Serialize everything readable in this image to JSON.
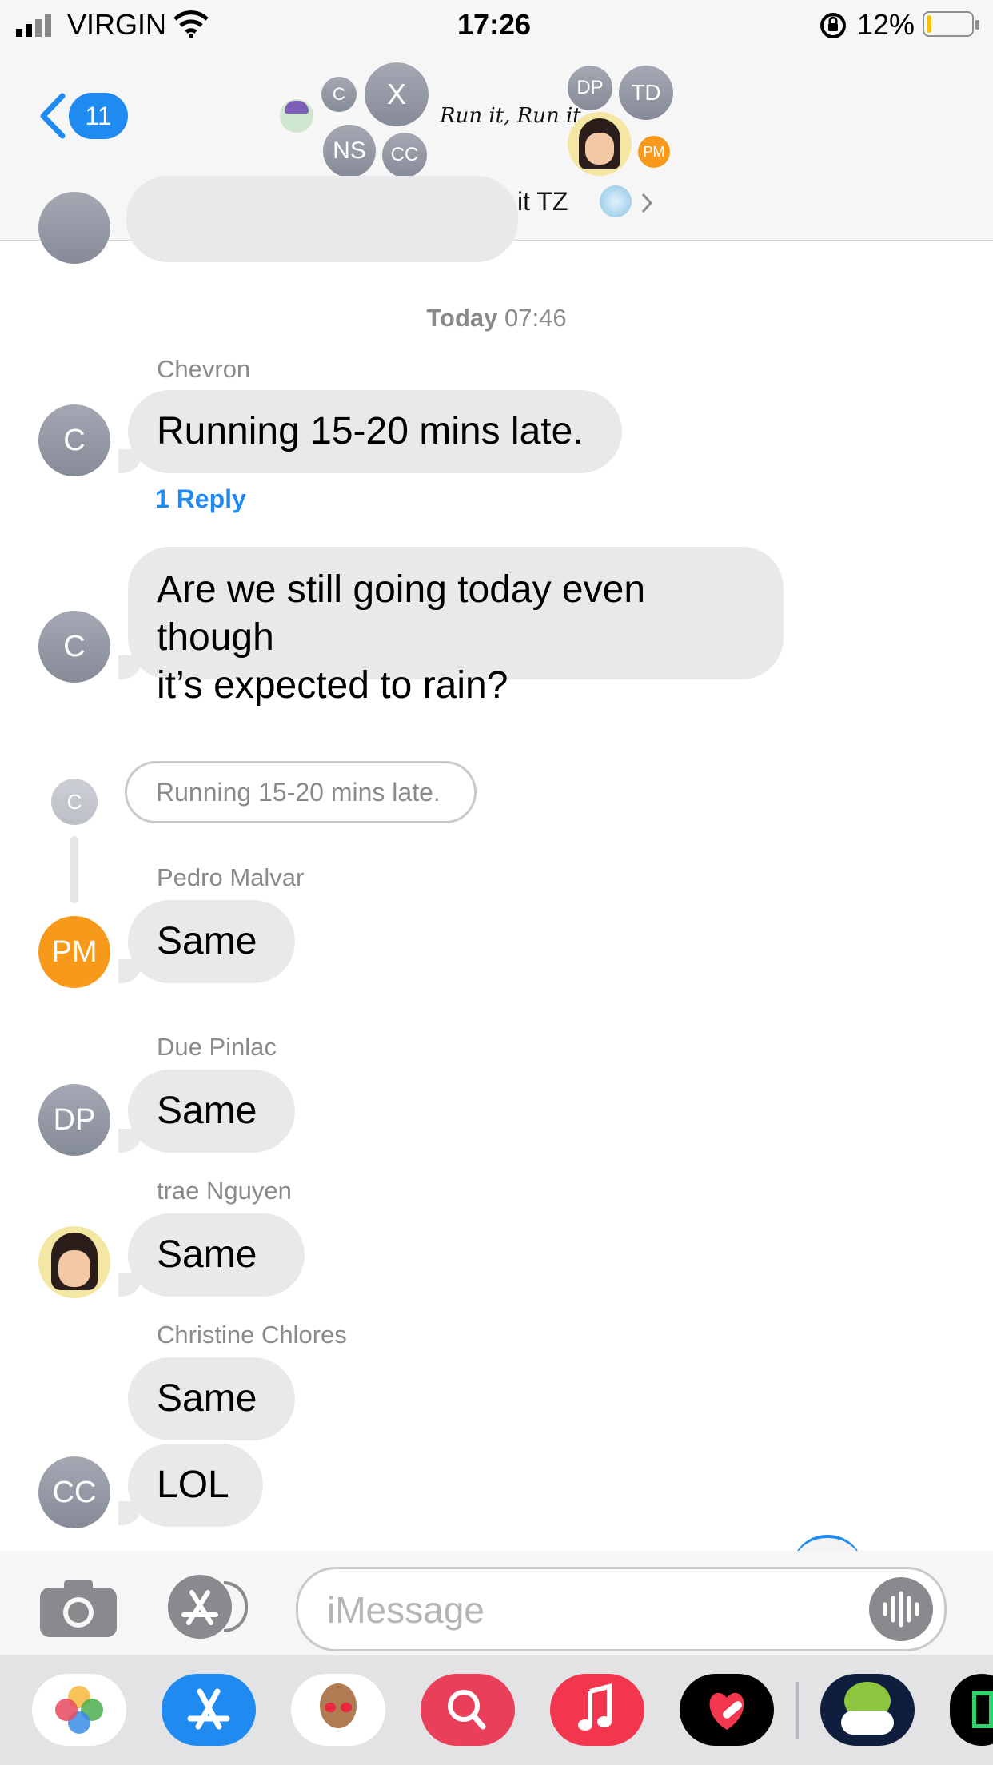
{
  "status_bar": {
    "carrier": "VIRGIN",
    "time": "17:26",
    "battery": "12%",
    "battery_level": 0.12
  },
  "header": {
    "back_count": "11",
    "group_name": "Run it, Run it TZ",
    "logo_text": "Run it, Run it",
    "avatars": [
      "C",
      "X",
      "NS",
      "CC",
      "DP",
      "TD",
      "PM"
    ]
  },
  "messages": {
    "timestamp_day": "Today",
    "timestamp_time": "07:46",
    "m1": {
      "sender": "Chevron",
      "text": "Running 15-20 mins late.",
      "reply": "1 Reply",
      "initial": "C"
    },
    "m2": {
      "line1": "Are we still going today even though",
      "line2": "it’s expected to rain?",
      "initial": "C"
    },
    "quoted": {
      "initial": "C",
      "text": "Running 15-20 mins late."
    },
    "m3": {
      "sender": "Pedro Malvar",
      "text": "Same",
      "initial": "PM"
    },
    "m4": {
      "sender": "Due Pinlac",
      "text": "Same",
      "initial": "DP"
    },
    "m5": {
      "sender": "trae Nguyen",
      "text": "Same"
    },
    "m6": {
      "sender": "Christine Chlores",
      "text1": "Same",
      "text2": "LOL",
      "initial": "CC"
    }
  },
  "input": {
    "placeholder": "iMessage"
  },
  "dock": {
    "apps": [
      "photos",
      "app-store",
      "memoji",
      "search-web",
      "music",
      "fitness",
      "game"
    ]
  },
  "colors": {
    "accent": "#1f8aef",
    "bubble": "#e9e9eb",
    "pm_avatar": "#f79a1b"
  }
}
